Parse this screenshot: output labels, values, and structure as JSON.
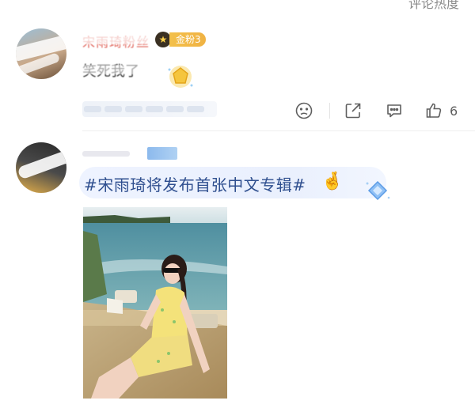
{
  "top": {
    "link_text": "评论热度"
  },
  "comments": [
    {
      "username": "宋雨琦粉丝",
      "fan_badge": "金粉3",
      "text": "笑死我了",
      "actions": {
        "like_count": "6"
      }
    },
    {
      "hashtag": "#宋雨琦将发布首张中文专辑#",
      "emoji": "🤞"
    }
  ],
  "colors": {
    "accent_blue": "#2f4f8f",
    "badge_gold": "#f3c04a",
    "icon_gray": "#5f5f5f"
  },
  "icons": [
    "sad-face-icon",
    "share-icon",
    "comment-icon",
    "thumbs-up-icon",
    "medal-icon",
    "diamond-icon",
    "crown-icon"
  ]
}
